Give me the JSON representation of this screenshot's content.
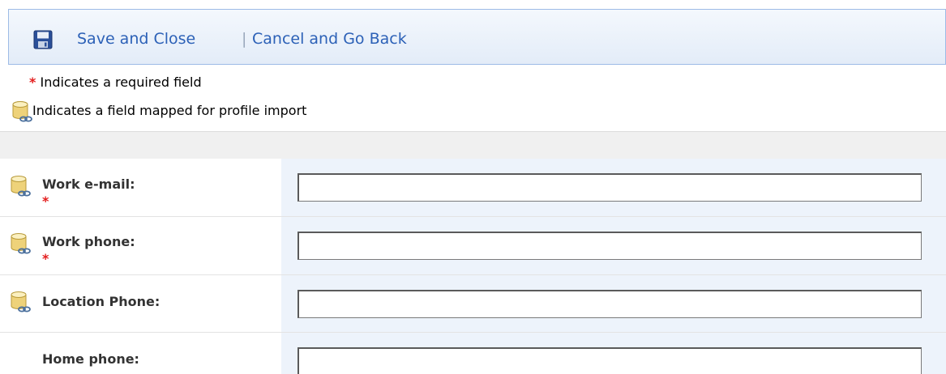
{
  "toolbar": {
    "save_close": "Save and Close",
    "separator": "|",
    "cancel_back": "Cancel and Go Back"
  },
  "legend": {
    "required_star": "*",
    "required_text": "Indicates a required field",
    "mapped_text": "Indicates a field mapped for profile import"
  },
  "fields": [
    {
      "label": "Work e-mail:",
      "required": "*",
      "value": "",
      "mapped": true
    },
    {
      "label": "Work phone:",
      "required": "*",
      "value": "",
      "mapped": true
    },
    {
      "label": "Location Phone:",
      "required": "",
      "value": "",
      "mapped": true
    },
    {
      "label": "Home phone:",
      "required": "",
      "value": "",
      "mapped": false
    }
  ],
  "colors": {
    "link": "#2c61b7",
    "required": "#e31c1c",
    "value_column_bg": "#edf3fb",
    "toolbar_border": "#9dbbe6"
  }
}
